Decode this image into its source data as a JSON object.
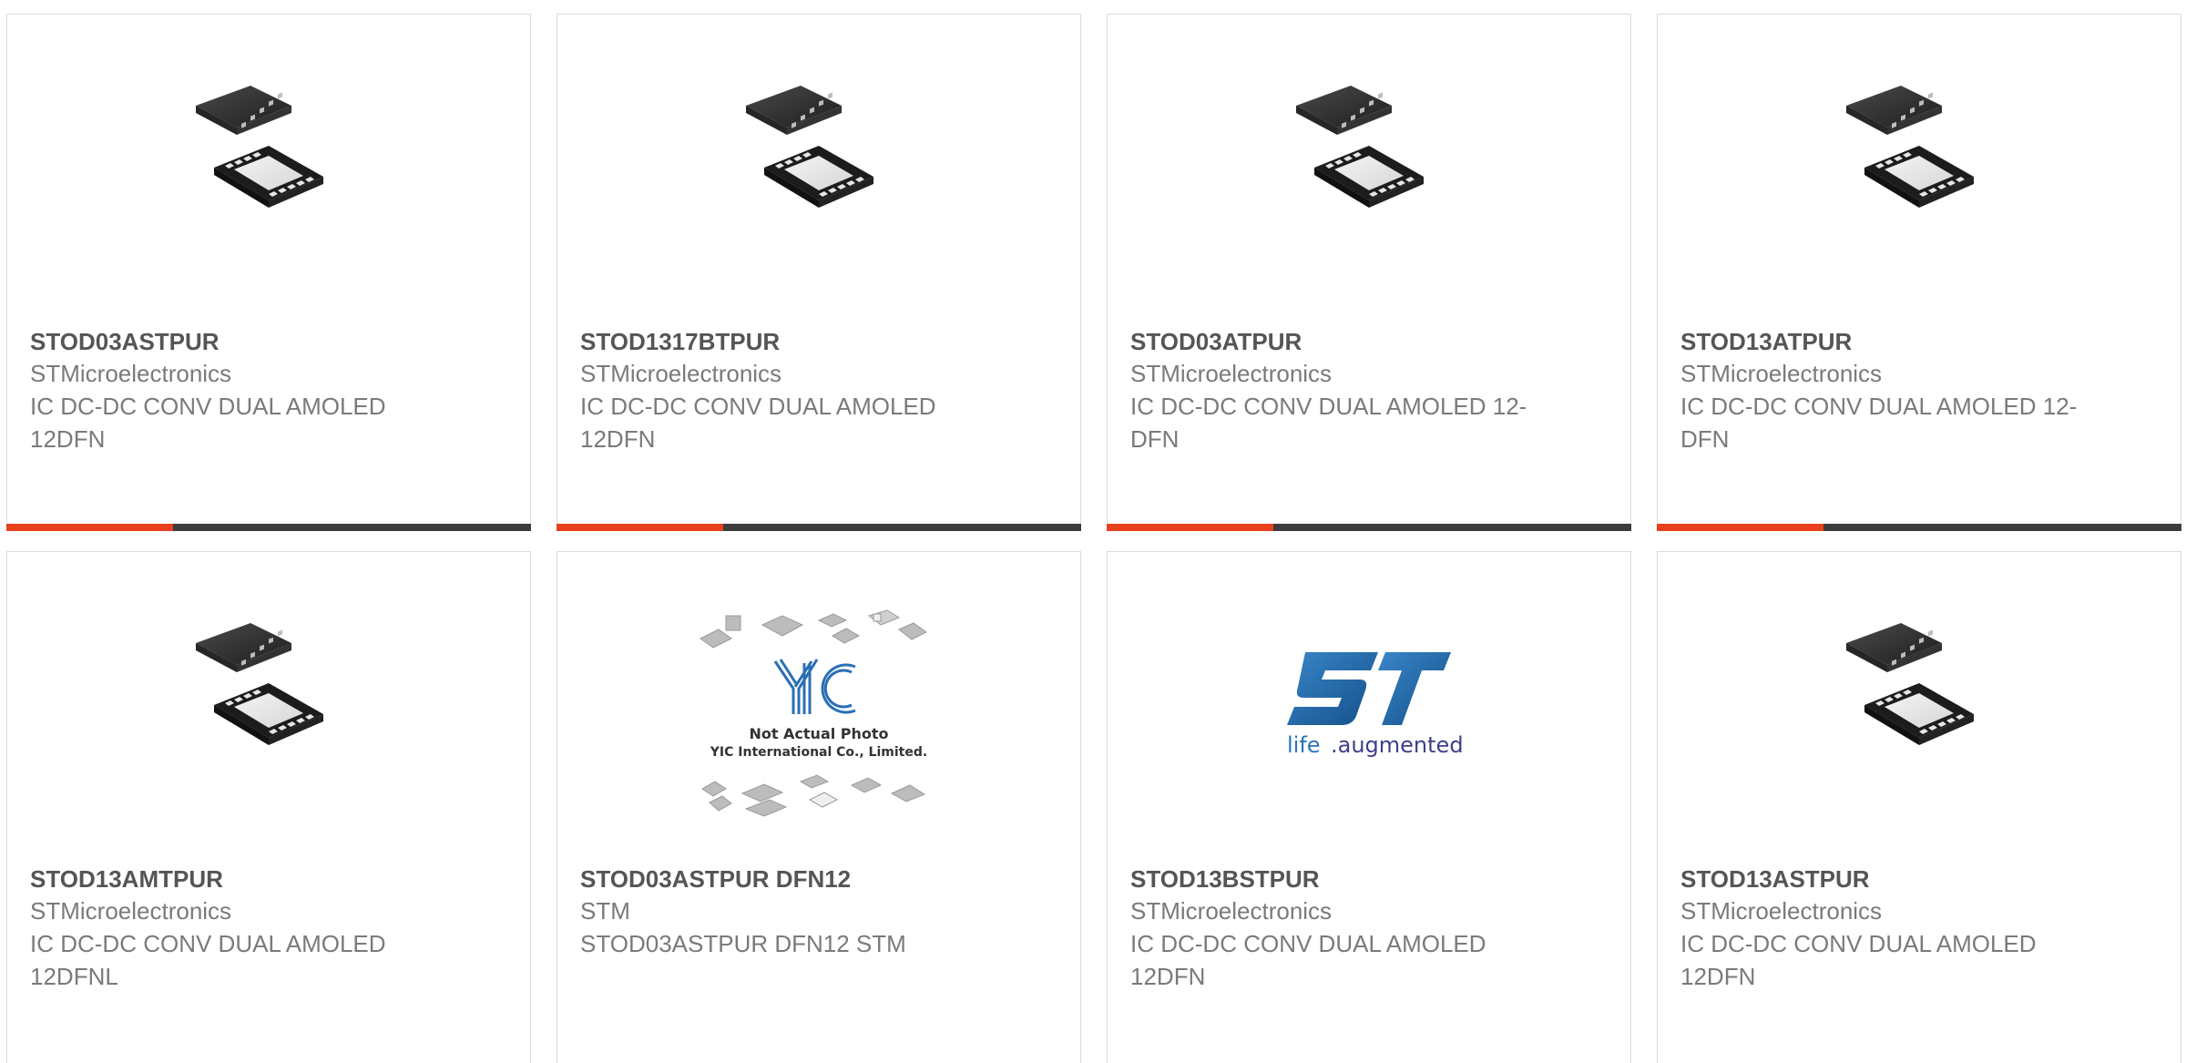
{
  "colors": {
    "accent": "#e8401c",
    "bar": "#3c3c3c",
    "title_text": "#555555",
    "body_text": "#7a7a7a",
    "border": "#dcdcdc",
    "st_logo_blue": "#1f6bb0"
  },
  "products": [
    {
      "part_number": "STOD03ASTPUR",
      "manufacturer": "STMicroelectronics",
      "description": "IC DC-DC CONV DUAL AMOLED 12DFN",
      "image_icon": "dfn-chip-icon"
    },
    {
      "part_number": "STOD1317BTPUR",
      "manufacturer": "STMicroelectronics",
      "description": "IC DC-DC CONV DUAL AMOLED 12DFN",
      "image_icon": "dfn-chip-icon"
    },
    {
      "part_number": "STOD03ATPUR",
      "manufacturer": "STMicroelectronics",
      "description": "IC DC-DC CONV DUAL AMOLED 12-DFN",
      "image_icon": "dfn-chip-icon"
    },
    {
      "part_number": "STOD13ATPUR",
      "manufacturer": "STMicroelectronics",
      "description": "IC DC-DC CONV DUAL AMOLED 12-DFN",
      "image_icon": "dfn-chip-icon"
    },
    {
      "part_number": "STOD13AMTPUR",
      "manufacturer": "STMicroelectronics",
      "description": "IC DC-DC CONV DUAL AMOLED 12DFNL",
      "image_icon": "dfn-chip-icon"
    },
    {
      "part_number": "STOD03ASTPUR DFN12",
      "manufacturer": "STM",
      "description": "STOD03ASTPUR DFN12 STM",
      "image_icon": "placeholder-photo-icon",
      "placeholder": {
        "logo": "YIC",
        "line1": "Not Actual Photo",
        "line2": "YIC International Co., Limited."
      }
    },
    {
      "part_number": "STOD13BSTPUR",
      "manufacturer": "STMicroelectronics",
      "description": "IC DC-DC CONV DUAL AMOLED 12DFN",
      "image_icon": "st-logo-icon",
      "st_logo": {
        "brand": "ST",
        "tagline_a": "life",
        "tagline_b": ".augmented"
      }
    },
    {
      "part_number": "STOD13ASTPUR",
      "manufacturer": "STMicroelectronics",
      "description": "IC DC-DC CONV DUAL AMOLED 12DFN",
      "image_icon": "dfn-chip-icon"
    }
  ]
}
